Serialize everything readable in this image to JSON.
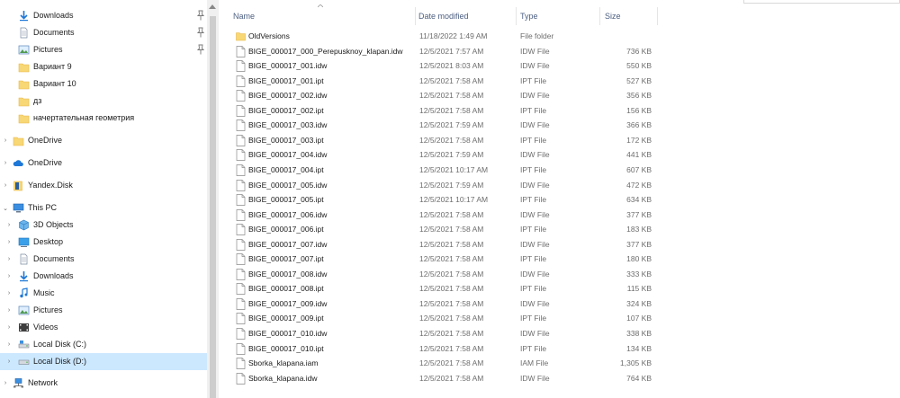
{
  "nav": {
    "items": [
      {
        "label": "Downloads",
        "icon": "download-arrow-icon",
        "pinned": true,
        "indent": 1,
        "expander": false
      },
      {
        "label": "Documents",
        "icon": "documents-icon",
        "pinned": true,
        "indent": 1,
        "expander": false
      },
      {
        "label": "Pictures",
        "icon": "pictures-icon",
        "pinned": true,
        "indent": 1,
        "expander": false
      },
      {
        "label": "Вариант 9",
        "icon": "folder-icon",
        "pinned": false,
        "indent": 1,
        "expander": false
      },
      {
        "label": "Вариант 10",
        "icon": "folder-icon",
        "pinned": false,
        "indent": 1,
        "expander": false
      },
      {
        "label": "дз",
        "icon": "folder-icon",
        "pinned": false,
        "indent": 1,
        "expander": false
      },
      {
        "label": "начертательная геометрия",
        "icon": "folder-icon",
        "pinned": false,
        "indent": 1,
        "expander": false
      },
      {
        "label": "OneDrive",
        "icon": "folder-icon",
        "pinned": false,
        "indent": 0,
        "expander": true
      },
      {
        "label": "OneDrive",
        "icon": "onedrive-cloud-icon",
        "pinned": false,
        "indent": 0,
        "expander": true
      },
      {
        "label": "Yandex.Disk",
        "icon": "yandex-disk-icon",
        "pinned": false,
        "indent": 0,
        "expander": true
      },
      {
        "label": "This PC",
        "icon": "this-pc-icon",
        "pinned": false,
        "indent": 0,
        "expander": true
      },
      {
        "label": "3D Objects",
        "icon": "3d-objects-icon",
        "pinned": false,
        "indent": 1,
        "expander": true
      },
      {
        "label": "Desktop",
        "icon": "desktop-icon",
        "pinned": false,
        "indent": 1,
        "expander": true
      },
      {
        "label": "Documents",
        "icon": "documents-icon",
        "pinned": false,
        "indent": 1,
        "expander": true
      },
      {
        "label": "Downloads",
        "icon": "download-arrow-icon",
        "pinned": false,
        "indent": 1,
        "expander": true
      },
      {
        "label": "Music",
        "icon": "music-note-icon",
        "pinned": false,
        "indent": 1,
        "expander": true
      },
      {
        "label": "Pictures",
        "icon": "pictures-icon",
        "pinned": false,
        "indent": 1,
        "expander": true
      },
      {
        "label": "Videos",
        "icon": "videos-icon",
        "pinned": false,
        "indent": 1,
        "expander": true
      },
      {
        "label": "Local Disk (C:)",
        "icon": "local-disk-c-icon",
        "pinned": false,
        "indent": 1,
        "expander": true
      },
      {
        "label": "Local Disk (D:)",
        "icon": "local-disk-icon",
        "pinned": false,
        "indent": 1,
        "expander": true,
        "selected": true
      },
      {
        "label": "Network",
        "icon": "network-icon",
        "pinned": false,
        "indent": 0,
        "expander": true
      }
    ]
  },
  "columns": {
    "name": "Name",
    "date": "Date modified",
    "type": "Type",
    "size": "Size"
  },
  "files": [
    {
      "name": "OldVersions",
      "date": "11/18/2022 1:49 AM",
      "type": "File folder",
      "size": "",
      "kind": "folder"
    },
    {
      "name": "BIGE_000017_000_Perepusknoy_klapan.idw",
      "date": "12/5/2021 7:57 AM",
      "type": "IDW File",
      "size": "736 KB",
      "kind": "file"
    },
    {
      "name": "BIGE_000017_001.idw",
      "date": "12/5/2021 8:03 AM",
      "type": "IDW File",
      "size": "550 KB",
      "kind": "file"
    },
    {
      "name": "BIGE_000017_001.ipt",
      "date": "12/5/2021 7:58 AM",
      "type": "IPT File",
      "size": "527 KB",
      "kind": "file"
    },
    {
      "name": "BIGE_000017_002.idw",
      "date": "12/5/2021 7:58 AM",
      "type": "IDW File",
      "size": "356 KB",
      "kind": "file"
    },
    {
      "name": "BIGE_000017_002.ipt",
      "date": "12/5/2021 7:58 AM",
      "type": "IPT File",
      "size": "156 KB",
      "kind": "file"
    },
    {
      "name": "BIGE_000017_003.idw",
      "date": "12/5/2021 7:59 AM",
      "type": "IDW File",
      "size": "366 KB",
      "kind": "file"
    },
    {
      "name": "BIGE_000017_003.ipt",
      "date": "12/5/2021 7:58 AM",
      "type": "IPT File",
      "size": "172 KB",
      "kind": "file"
    },
    {
      "name": "BIGE_000017_004.idw",
      "date": "12/5/2021 7:59 AM",
      "type": "IDW File",
      "size": "441 KB",
      "kind": "file"
    },
    {
      "name": "BIGE_000017_004.ipt",
      "date": "12/5/2021 10:17 AM",
      "type": "IPT File",
      "size": "607 KB",
      "kind": "file"
    },
    {
      "name": "BIGE_000017_005.idw",
      "date": "12/5/2021 7:59 AM",
      "type": "IDW File",
      "size": "472 KB",
      "kind": "file"
    },
    {
      "name": "BIGE_000017_005.ipt",
      "date": "12/5/2021 10:17 AM",
      "type": "IPT File",
      "size": "634 KB",
      "kind": "file"
    },
    {
      "name": "BIGE_000017_006.idw",
      "date": "12/5/2021 7:58 AM",
      "type": "IDW File",
      "size": "377 KB",
      "kind": "file"
    },
    {
      "name": "BIGE_000017_006.ipt",
      "date": "12/5/2021 7:58 AM",
      "type": "IPT File",
      "size": "183 KB",
      "kind": "file"
    },
    {
      "name": "BIGE_000017_007.idw",
      "date": "12/5/2021 7:58 AM",
      "type": "IDW File",
      "size": "377 KB",
      "kind": "file"
    },
    {
      "name": "BIGE_000017_007.ipt",
      "date": "12/5/2021 7:58 AM",
      "type": "IPT File",
      "size": "180 KB",
      "kind": "file"
    },
    {
      "name": "BIGE_000017_008.idw",
      "date": "12/5/2021 7:58 AM",
      "type": "IDW File",
      "size": "333 KB",
      "kind": "file"
    },
    {
      "name": "BIGE_000017_008.ipt",
      "date": "12/5/2021 7:58 AM",
      "type": "IPT File",
      "size": "115 KB",
      "kind": "file"
    },
    {
      "name": "BIGE_000017_009.idw",
      "date": "12/5/2021 7:58 AM",
      "type": "IDW File",
      "size": "324 KB",
      "kind": "file"
    },
    {
      "name": "BIGE_000017_009.ipt",
      "date": "12/5/2021 7:58 AM",
      "type": "IPT File",
      "size": "107 KB",
      "kind": "file"
    },
    {
      "name": "BIGE_000017_010.idw",
      "date": "12/5/2021 7:58 AM",
      "type": "IDW File",
      "size": "338 KB",
      "kind": "file"
    },
    {
      "name": "BIGE_000017_010.ipt",
      "date": "12/5/2021 7:58 AM",
      "type": "IPT File",
      "size": "134 KB",
      "kind": "file"
    },
    {
      "name": "Sborka_klapana.iam",
      "date": "12/5/2021 7:58 AM",
      "type": "IAM File",
      "size": "1,305 KB",
      "kind": "file"
    },
    {
      "name": "Sborka_klapana.idw",
      "date": "12/5/2021 7:58 AM",
      "type": "IDW File",
      "size": "764 KB",
      "kind": "file"
    }
  ],
  "colors": {
    "folder": "#f8d775",
    "folder_dark": "#e8b84a",
    "selected_bg": "#cce8ff",
    "header_text": "#4d6082",
    "accent_blue": "#1e78d7"
  }
}
